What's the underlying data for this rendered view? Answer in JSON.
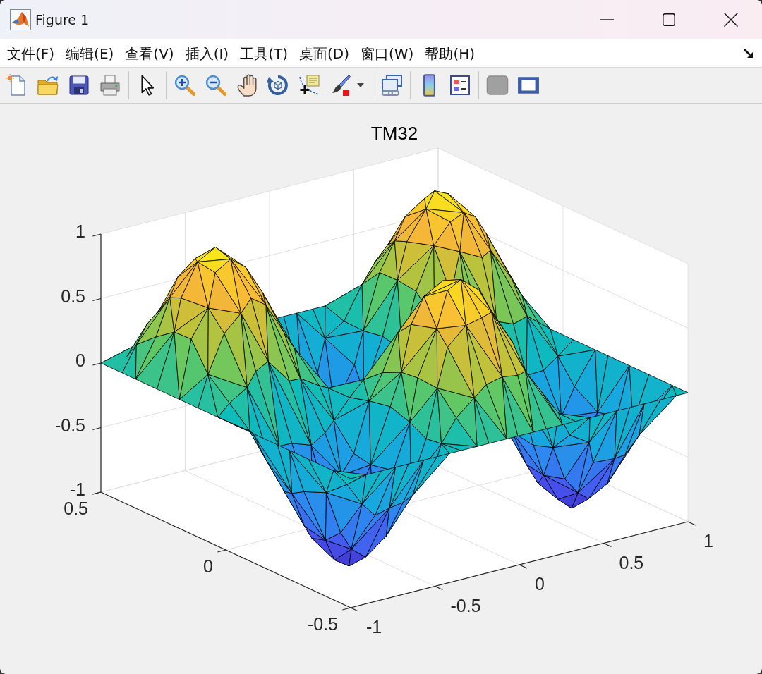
{
  "window": {
    "title": "Figure 1"
  },
  "menu": [
    "文件(F)",
    "编辑(E)",
    "查看(V)",
    "插入(I)",
    "工具(T)",
    "桌面(D)",
    "窗口(W)",
    "帮助(H)"
  ],
  "plot": {
    "title": "TM32",
    "vertical_axis_ticks": [
      "1",
      "0.5",
      "0",
      "-0.5",
      "-1"
    ],
    "left_axis_ticks": [
      "0.5",
      "0",
      "-0.5"
    ],
    "right_axis_ticks": [
      "-1",
      "-0.5",
      "0",
      "0.5",
      "1"
    ]
  }
}
